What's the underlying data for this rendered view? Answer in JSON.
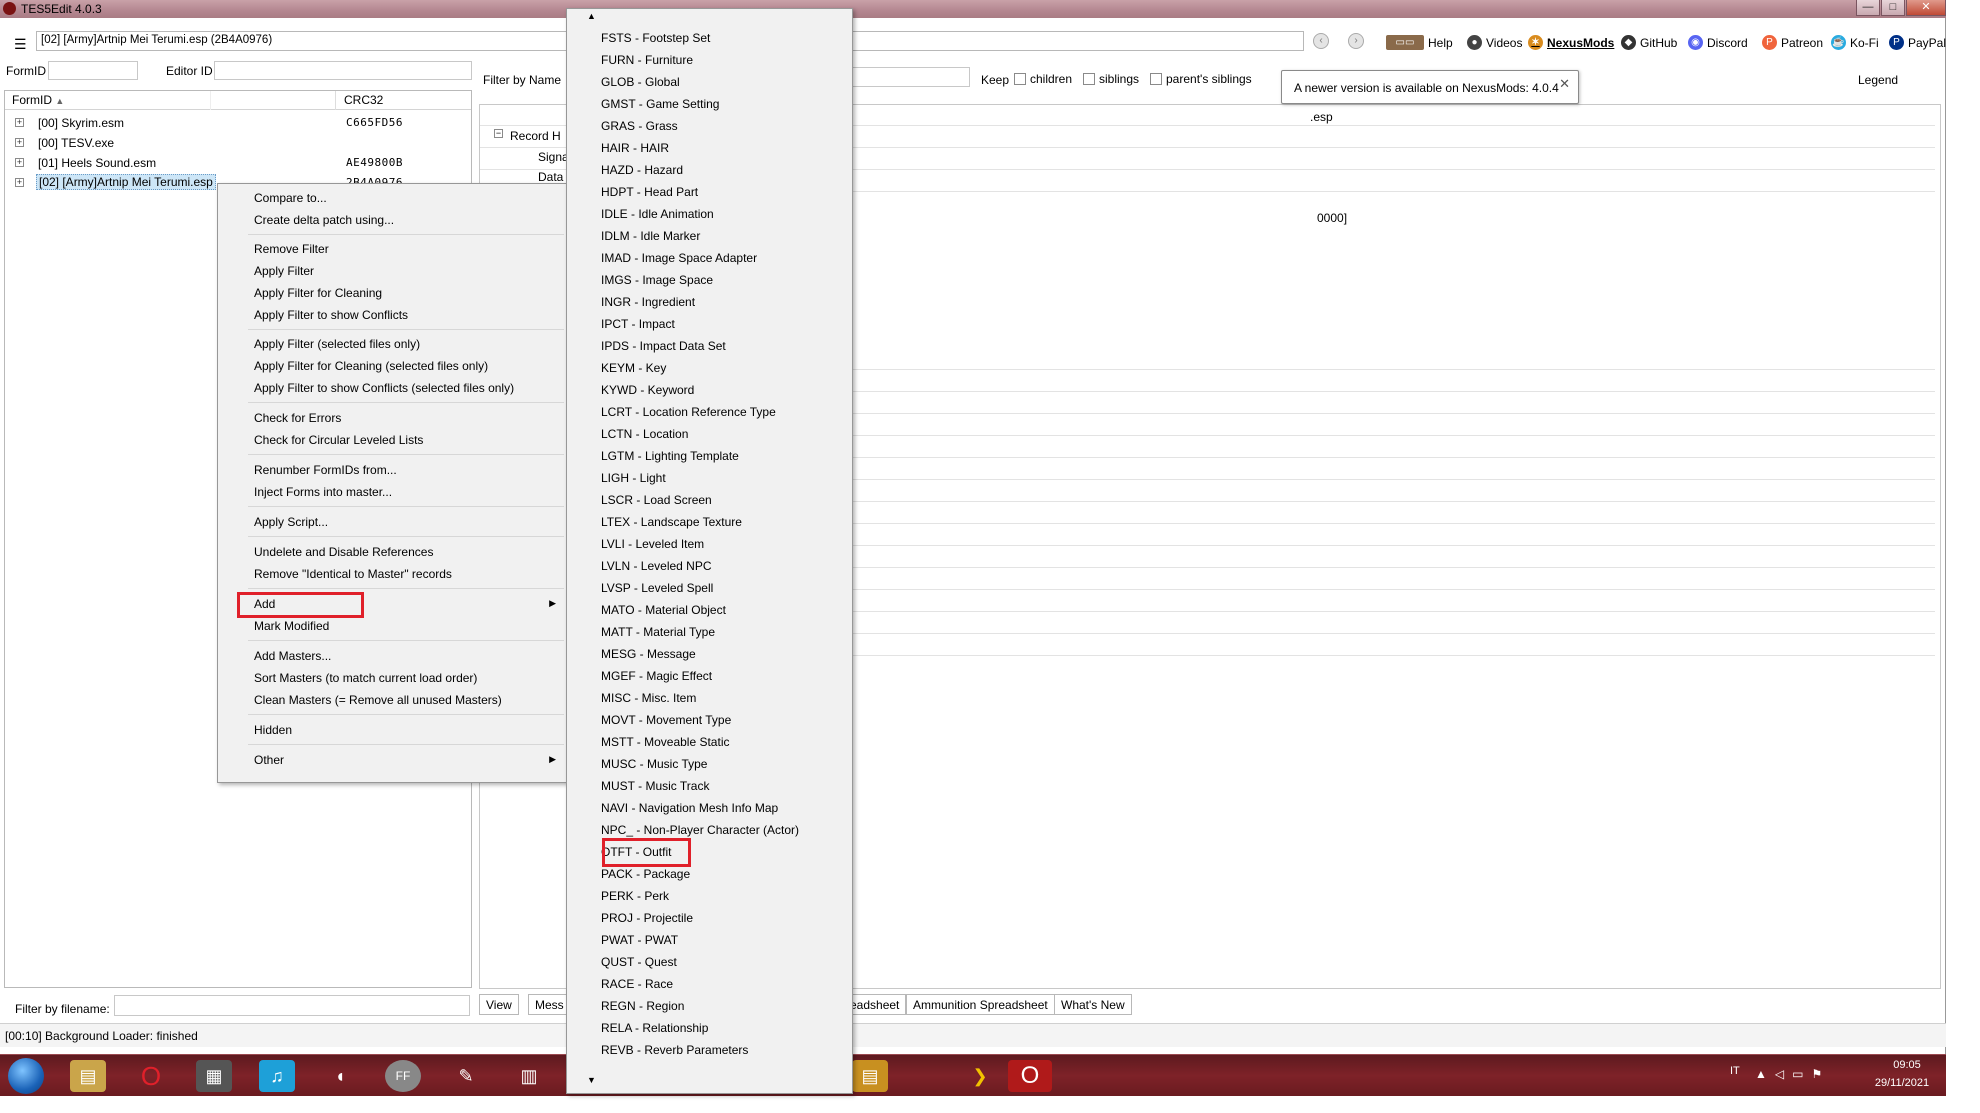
{
  "window": {
    "title": "TES5Edit 4.0.3"
  },
  "toolbar": {
    "path": "[02] [Army]Artnip Mei Terumi.esp (2B4A0976)",
    "links": [
      {
        "label": "Help",
        "icon": "book-icon"
      },
      {
        "label": "Videos",
        "icon": "video-icon"
      },
      {
        "label": "NexusMods",
        "icon": "nexus-icon"
      },
      {
        "label": "GitHub",
        "icon": "github-icon"
      },
      {
        "label": "Discord",
        "icon": "discord-icon"
      },
      {
        "label": "Patreon",
        "icon": "patreon-icon"
      },
      {
        "label": "Ko-Fi",
        "icon": "kofi-icon"
      },
      {
        "label": "PayPal",
        "icon": "paypal-icon"
      }
    ]
  },
  "filters": {
    "formid_label": "FormID",
    "editorid_label": "Editor ID",
    "filter_by_name_label": "Filter by Name",
    "keep_label": "Keep",
    "children_label": "children",
    "siblings_label": "siblings",
    "parents_siblings_label": "parent's siblings",
    "legend_label": "Legend",
    "filter_by_filename_label": "Filter by filename:"
  },
  "tooltip": {
    "text": "A newer version is available on NexusMods: 4.0.4",
    "close": "✕"
  },
  "tree": {
    "col_formid": "FormID",
    "col_crc": "CRC32",
    "rows": [
      {
        "name": "[00] Skyrim.esm",
        "crc": "C665FD56"
      },
      {
        "name": "[00] TESV.exe",
        "crc": ""
      },
      {
        "name": "[01] Heels Sound.esm",
        "crc": "AE49800B"
      },
      {
        "name": "[02] [Army]Artnip Mei Terumi.esp",
        "crc": "2B4A0976"
      }
    ]
  },
  "record": {
    "record_header": "Record H",
    "signature": "Signa",
    "data": "Data",
    "col_esp": ".esp",
    "value_fragment": "0000]"
  },
  "bottom_tabs": [
    "View",
    "Mess",
    "eadsheet",
    "Ammunition Spreadsheet",
    "What's New"
  ],
  "status": {
    "text": "[00:10] Background Loader: finished"
  },
  "context_menu": {
    "items": [
      "Compare to...",
      "Create delta patch using...",
      "Remove Filter",
      "Apply Filter",
      "Apply Filter for Cleaning",
      "Apply Filter to show Conflicts",
      "Apply Filter (selected files only)",
      "Apply Filter for Cleaning (selected files only)",
      "Apply Filter to show Conflicts (selected files only)",
      "Check for Errors",
      "Check for Circular Leveled Lists",
      "Renumber FormIDs from...",
      "Inject Forms into master...",
      "Apply Script...",
      "Undelete and Disable References",
      "Remove \"Identical to Master\" records",
      "Add",
      "Mark Modified",
      "Add Masters...",
      "Sort Masters (to match current load order)",
      "Clean Masters (= Remove all unused Masters)",
      "Hidden",
      "Other"
    ]
  },
  "submenu": {
    "items": [
      "FSTS - Footstep Set",
      "FURN - Furniture",
      "GLOB - Global",
      "GMST - Game Setting",
      "GRAS - Grass",
      "HAIR - HAIR",
      "HAZD - Hazard",
      "HDPT - Head Part",
      "IDLE - Idle Animation",
      "IDLM - Idle Marker",
      "IMAD - Image Space Adapter",
      "IMGS - Image Space",
      "INGR - Ingredient",
      "IPCT - Impact",
      "IPDS - Impact Data Set",
      "KEYM - Key",
      "KYWD - Keyword",
      "LCRT - Location Reference Type",
      "LCTN - Location",
      "LGTM - Lighting Template",
      "LIGH - Light",
      "LSCR - Load Screen",
      "LTEX - Landscape Texture",
      "LVLI - Leveled Item",
      "LVLN - Leveled NPC",
      "LVSP - Leveled Spell",
      "MATO - Material Object",
      "MATT - Material Type",
      "MESG - Message",
      "MGEF - Magic Effect",
      "MISC - Misc. Item",
      "MOVT - Movement Type",
      "MSTT - Moveable Static",
      "MUSC - Music Type",
      "MUST - Music Track",
      "NAVI - Navigation Mesh Info Map",
      "NPC_ - Non-Player Character (Actor)",
      "OTFT - Outfit",
      "PACK - Package",
      "PERK - Perk",
      "PROJ - Projectile",
      "PWAT - PWAT",
      "QUST - Quest",
      "RACE - Race",
      "REGN - Region",
      "RELA - Relationship",
      "REVB - Reverb Parameters"
    ]
  },
  "tray": {
    "lang": "IT",
    "time": "09:05",
    "date": "29/11/2021"
  },
  "colors": {
    "highlight": "#e0202a",
    "taskbar": "#7e2228"
  }
}
